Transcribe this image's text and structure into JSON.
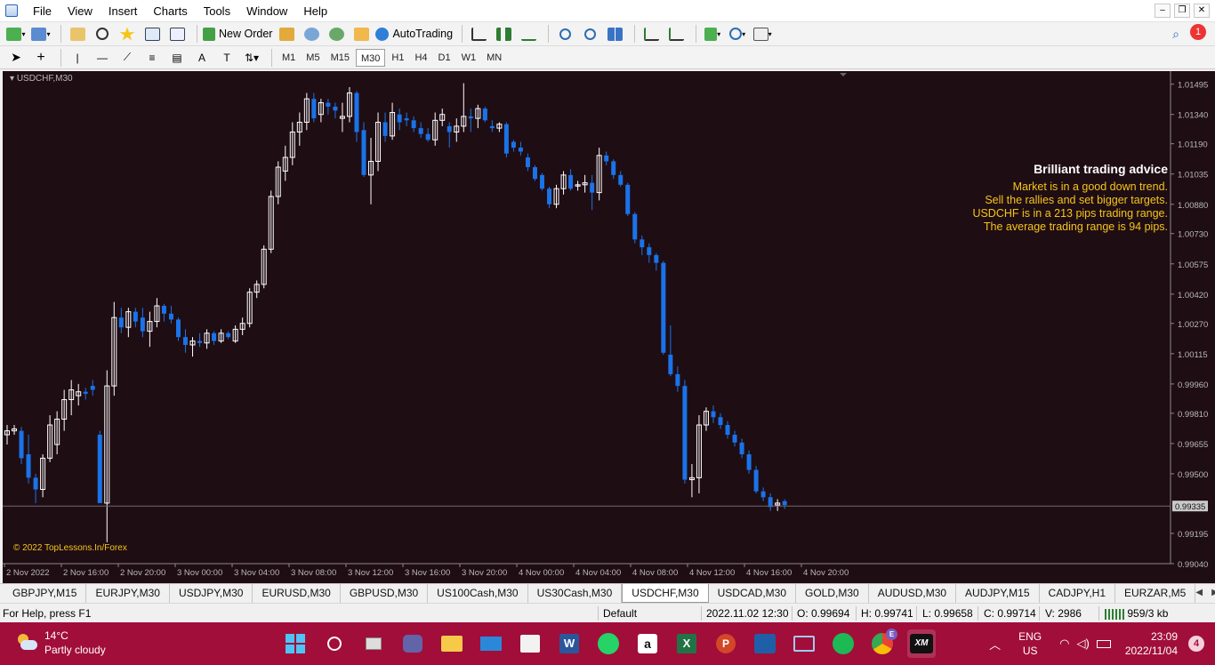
{
  "menu": [
    "File",
    "View",
    "Insert",
    "Charts",
    "Tools",
    "Window",
    "Help"
  ],
  "toolbar": {
    "new_order_label": "New Order",
    "autotrading_label": "AutoTrading",
    "alert_count": "1",
    "timeframes": [
      "M1",
      "M5",
      "M15",
      "M30",
      "H1",
      "H4",
      "D1",
      "W1",
      "MN"
    ],
    "active_timeframe": "M30"
  },
  "chart": {
    "title": "USDCHF,M30",
    "copyright": "© 2022 TopLessons.In/Forex",
    "background": "#1f0d14",
    "bull_color": "#ffffff",
    "bear_color": "#1a73e8",
    "advice": {
      "title": "Brilliant trading advice",
      "lines": [
        "Market is in a good down trend.",
        "Sell the rallies and set bigger targets.",
        "USDCHF is in a 213 pips trading range.",
        "The average trading range is 94 pips."
      ]
    }
  },
  "chart_data": {
    "type": "candlestick",
    "symbol": "USDCHF",
    "timeframe": "M30",
    "ylim": [
      0.9904,
      1.0153
    ],
    "y_ticks": [
      "1.01495",
      "1.01340",
      "1.01190",
      "1.01035",
      "1.00880",
      "1.00730",
      "1.00575",
      "1.00420",
      "1.00270",
      "1.00115",
      "0.99960",
      "0.99810",
      "0.99655",
      "0.99500",
      "0.99335",
      "0.99195",
      "0.99040"
    ],
    "x_ticks": [
      "2 Nov 2022",
      "2 Nov 16:00",
      "2 Nov 20:00",
      "3 Nov 00:00",
      "3 Nov 04:00",
      "3 Nov 08:00",
      "3 Nov 12:00",
      "3 Nov 16:00",
      "3 Nov 20:00",
      "4 Nov 00:00",
      "4 Nov 04:00",
      "4 Nov 08:00",
      "4 Nov 12:00",
      "4 Nov 16:00",
      "4 Nov 20:00"
    ],
    "current_price": "0.99335",
    "candles": [
      [
        0.997,
        0.9975,
        0.9965,
        0.9972
      ],
      [
        0.9972,
        0.9975,
        0.997,
        0.9973
      ],
      [
        0.9972,
        0.9974,
        0.9955,
        0.9958
      ],
      [
        0.996,
        0.997,
        0.9945,
        0.9948
      ],
      [
        0.9948,
        0.995,
        0.9935,
        0.9942
      ],
      [
        0.9942,
        0.996,
        0.9938,
        0.9958
      ],
      [
        0.9958,
        0.998,
        0.9956,
        0.9975
      ],
      [
        0.9965,
        0.9982,
        0.996,
        0.9978
      ],
      [
        0.9978,
        0.9993,
        0.9972,
        0.9988
      ],
      [
        0.9988,
        0.9998,
        0.998,
        0.9993
      ],
      [
        0.999,
        0.9996,
        0.9985,
        0.9992
      ],
      [
        0.9992,
        0.9994,
        0.9988,
        0.9991
      ],
      [
        0.9995,
        0.9998,
        0.999,
        0.9993
      ],
      [
        0.997,
        0.9972,
        0.9935,
        0.9935
      ],
      [
        0.9935,
        1.0003,
        0.9915,
        0.9995
      ],
      [
        0.9995,
        1.0038,
        0.999,
        1.003
      ],
      [
        1.003,
        1.0035,
        1.0022,
        1.0025
      ],
      [
        1.0025,
        1.0035,
        1.002,
        1.0033
      ],
      [
        1.0033,
        1.0035,
        1.0025,
        1.0028
      ],
      [
        1.003,
        1.0035,
        1.002,
        1.0023
      ],
      [
        1.0023,
        1.0033,
        1.0015,
        1.0028
      ],
      [
        1.0028,
        1.004,
        1.0025,
        1.0036
      ],
      [
        1.0036,
        1.0037,
        1.0028,
        1.0032
      ],
      [
        1.0032,
        1.0036,
        1.0027,
        1.0029
      ],
      [
        1.0029,
        1.003,
        1.0018,
        1.002
      ],
      [
        1.002,
        1.0024,
        1.0012,
        1.0016
      ],
      [
        1.0016,
        1.002,
        1.001,
        1.0018
      ],
      [
        1.0018,
        1.0022,
        1.0015,
        1.0017
      ],
      [
        1.0017,
        1.0024,
        1.0014,
        1.0022
      ],
      [
        1.0022,
        1.0023,
        1.0016,
        1.0018
      ],
      [
        1.0018,
        1.0024,
        1.0017,
        1.0022
      ],
      [
        1.0022,
        1.0023,
        1.0019,
        1.002
      ],
      [
        1.0018,
        1.0026,
        1.0017,
        1.0024
      ],
      [
        1.0024,
        1.003,
        1.0021,
        1.0027
      ],
      [
        1.0027,
        1.0045,
        1.0025,
        1.0043
      ],
      [
        1.0043,
        1.0049,
        1.004,
        1.0047
      ],
      [
        1.0047,
        1.0067,
        1.0045,
        1.0065
      ],
      [
        1.0065,
        1.0095,
        1.0063,
        1.0092
      ],
      [
        1.0092,
        1.011,
        1.0088,
        1.0107
      ],
      [
        1.0105,
        1.0118,
        1.01,
        1.0112
      ],
      [
        1.0112,
        1.013,
        1.0108,
        1.0125
      ],
      [
        1.0125,
        1.0135,
        1.0118,
        1.013
      ],
      [
        1.013,
        1.0145,
        1.0126,
        1.0142
      ],
      [
        1.0142,
        1.0145,
        1.013,
        1.0132
      ],
      [
        1.0134,
        1.0142,
        1.013,
        1.014
      ],
      [
        1.014,
        1.0142,
        1.0134,
        1.0138
      ],
      [
        1.0138,
        1.014,
        1.0132,
        1.0136
      ],
      [
        1.0132,
        1.014,
        1.0125,
        1.0133
      ],
      [
        1.0133,
        1.0148,
        1.013,
        1.0145
      ],
      [
        1.0145,
        1.0146,
        1.012,
        1.0125
      ],
      [
        1.0126,
        1.013,
        1.0102,
        1.0103
      ],
      [
        1.0103,
        1.0122,
        1.0088,
        1.011
      ],
      [
        1.011,
        1.0135,
        1.0105,
        1.013
      ],
      [
        1.013,
        1.0135,
        1.012,
        1.0123
      ],
      [
        1.0123,
        1.014,
        1.0121,
        1.0135
      ],
      [
        1.0134,
        1.0137,
        1.0126,
        1.013
      ],
      [
        1.0132,
        1.0135,
        1.0128,
        1.0131
      ],
      [
        1.0131,
        1.0133,
        1.0125,
        1.0127
      ],
      [
        1.0127,
        1.013,
        1.0122,
        1.0124
      ],
      [
        1.0124,
        1.0127,
        1.012,
        1.0121
      ],
      [
        1.0121,
        1.0135,
        1.0118,
        1.0131
      ],
      [
        1.0131,
        1.0137,
        1.0128,
        1.0134
      ],
      [
        1.0128,
        1.013,
        1.0117,
        1.0125
      ],
      [
        1.0125,
        1.0132,
        1.012,
        1.0128
      ],
      [
        1.0128,
        1.015,
        1.0125,
        1.0133
      ],
      [
        1.0133,
        1.0137,
        1.0125,
        1.0132
      ],
      [
        1.0132,
        1.0139,
        1.0127,
        1.0137
      ],
      [
        1.0137,
        1.0138,
        1.013,
        1.0131
      ],
      [
        1.0128,
        1.0131,
        1.0125,
        1.0127
      ],
      [
        1.0127,
        1.013,
        1.0125,
        1.0129
      ],
      [
        1.0129,
        1.013,
        1.0112,
        1.0114
      ],
      [
        1.012,
        1.0121,
        1.0115,
        1.0117
      ],
      [
        1.0117,
        1.012,
        1.0113,
        1.0115
      ],
      [
        1.0112,
        1.0114,
        1.0105,
        1.0107
      ],
      [
        1.0107,
        1.0108,
        1.01,
        1.0101
      ],
      [
        1.0103,
        1.0104,
        1.0095,
        1.0096
      ],
      [
        1.0096,
        1.0097,
        1.0086,
        1.0088
      ],
      [
        1.0088,
        1.0098,
        1.0086,
        1.0096
      ],
      [
        1.0096,
        1.0105,
        1.0093,
        1.0103
      ],
      [
        1.0103,
        1.0106,
        1.0095,
        1.0096
      ],
      [
        1.0098,
        1.01,
        1.0095,
        1.0098
      ],
      [
        1.0098,
        1.0103,
        1.0094,
        1.0099
      ],
      [
        1.0099,
        1.0103,
        1.0085,
        1.0094
      ],
      [
        1.0094,
        1.0117,
        1.009,
        1.0113
      ],
      [
        1.0113,
        1.0115,
        1.0108,
        1.011
      ],
      [
        1.011,
        1.0111,
        1.0101,
        1.0103
      ],
      [
        1.0103,
        1.0105,
        1.0097,
        1.0098
      ],
      [
        1.0098,
        1.0099,
        1.0082,
        1.0083
      ],
      [
        1.0083,
        1.0084,
        1.0068,
        1.007
      ],
      [
        1.007,
        1.0072,
        1.0062,
        1.0066
      ],
      [
        1.0066,
        1.0068,
        1.0058,
        1.0062
      ],
      [
        1.0062,
        1.0063,
        1.0054,
        1.0058
      ],
      [
        1.0058,
        1.0059,
        1.0011,
        1.0012
      ],
      [
        1.0011,
        1.0026,
        1.0,
        1.0001
      ],
      [
        1.0001,
        1.0005,
        0.9992,
        0.9995
      ],
      [
        0.9995,
        0.9998,
        0.9945,
        0.9947
      ],
      [
        0.9947,
        0.9955,
        0.9938,
        0.9948
      ],
      [
        0.9948,
        0.998,
        0.994,
        0.9975
      ],
      [
        0.9975,
        0.9984,
        0.9972,
        0.9982
      ],
      [
        0.9982,
        0.9985,
        0.9976,
        0.9979
      ],
      [
        0.9979,
        0.9981,
        0.9973,
        0.9975
      ],
      [
        0.9975,
        0.9977,
        0.9968,
        0.997
      ],
      [
        0.997,
        0.9972,
        0.9964,
        0.9966
      ],
      [
        0.9966,
        0.9968,
        0.9958,
        0.996
      ],
      [
        0.996,
        0.9962,
        0.995,
        0.9952
      ],
      [
        0.9952,
        0.9954,
        0.994,
        0.9941
      ],
      [
        0.9941,
        0.9943,
        0.9936,
        0.9938
      ],
      [
        0.9938,
        0.994,
        0.9931,
        0.9933
      ],
      [
        0.9934,
        0.9937,
        0.9931,
        0.9935
      ],
      [
        0.9936,
        0.9937,
        0.9932,
        0.9934
      ]
    ]
  },
  "symbol_tabs": [
    "GBPJPY,M15",
    "EURJPY,M30",
    "USDJPY,M30",
    "EURUSD,M30",
    "GBPUSD,M30",
    "US100Cash,M30",
    "US30Cash,M30",
    "USDCHF,M30",
    "USDCAD,M30",
    "GOLD,M30",
    "AUDUSD,M30",
    "AUDJPY,M15",
    "CADJPY,H1",
    "EURZAR,M5"
  ],
  "active_tab": "USDCHF,M30",
  "status": {
    "help": "For Help, press F1",
    "profile": "Default",
    "datetime": "2022.11.02 12:30",
    "open": "O: 0.99694",
    "high": "H: 0.99741",
    "low": "L: 0.99658",
    "close": "C: 0.99714",
    "volume": "V: 2986",
    "traffic": "959/3 kb"
  },
  "taskbar": {
    "temp": "14°C",
    "condition": "Partly cloudy",
    "lang1": "ENG",
    "lang2": "US",
    "time": "23:09",
    "date": "2022/11/04",
    "notifications": "4",
    "chrome_badge": "E",
    "apps": [
      "windows-start-icon",
      "search-icon",
      "task-view-icon",
      "teams-icon",
      "file-explorer-icon",
      "mail-icon",
      "store-icon",
      "word-icon",
      "whatsapp-icon",
      "amazon-icon",
      "excel-icon",
      "powerpoint-icon",
      "education-icon",
      "stocks-icon",
      "spotify-icon",
      "chrome-icon",
      "xm-icon"
    ]
  }
}
